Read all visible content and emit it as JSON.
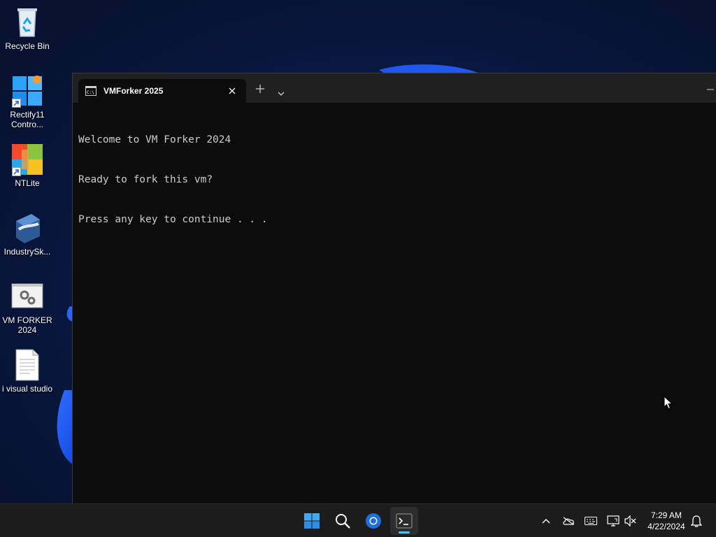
{
  "desktop": {
    "icons": [
      {
        "label": "Recycle Bin",
        "icon": "recycle-bin-icon"
      },
      {
        "label": "Rectify11\nContro...",
        "icon": "windows-logo-icon"
      },
      {
        "label": "NTLite",
        "icon": "ntlite-icon"
      },
      {
        "label": "IndustrySk...",
        "icon": "industry-sketch-icon"
      },
      {
        "label": "VM FORKER\n2024",
        "icon": "settings-window-icon"
      },
      {
        "label": "i visual studio",
        "icon": "text-document-icon"
      }
    ]
  },
  "terminal": {
    "tab_title": "VMForker 2025",
    "lines": [
      "Welcome to VM Forker 2024",
      "Ready to fork this vm?",
      "Press any key to continue . . ."
    ]
  },
  "taskbar": {
    "apps": [
      "start-icon",
      "search-icon",
      "chromium-icon",
      "terminal-icon"
    ],
    "tray": [
      "chevron-up-icon",
      "onedrive-icon",
      "keyboard-icon",
      "network-icon",
      "volume-muted-icon",
      "notification-bell-icon"
    ],
    "time": "7:29 AM",
    "date": "4/22/2024"
  },
  "colors": {
    "accent": "#4cc2ff",
    "console_bg": "#0c0c0c",
    "console_text": "#cccccc",
    "taskbar_bg": "#1c1c1c"
  }
}
